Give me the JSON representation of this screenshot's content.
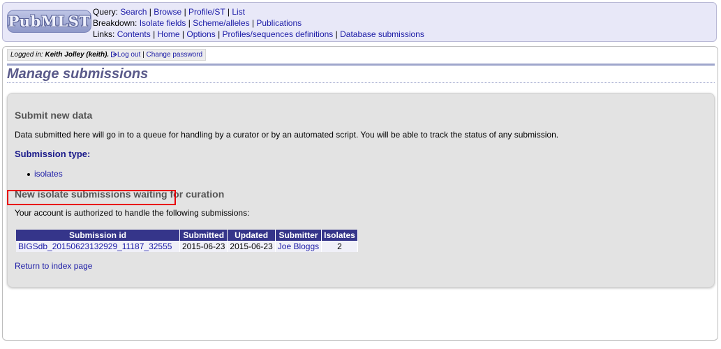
{
  "logo": {
    "text": "PubMLST"
  },
  "nav": {
    "query_label": "Query:",
    "query_links": [
      "Search",
      "Browse",
      "Profile/ST",
      "List"
    ],
    "breakdown_label": "Breakdown:",
    "breakdown_links": [
      "Isolate fields",
      "Scheme/alleles",
      "Publications"
    ],
    "links_label": "Links:",
    "links_links": [
      "Contents",
      "Home",
      "Options",
      "Profiles/sequences definitions",
      "Database submissions"
    ]
  },
  "login": {
    "prefix": "Logged in:",
    "user": "Keith Jolley (keith).",
    "logout": "Log out",
    "change_password": "Change password"
  },
  "page_title": "Manage submissions",
  "submit": {
    "heading": "Submit new data",
    "description": "Data submitted here will go in to a queue for handling by a curator or by an automated script. You will be able to track the status of any submission.",
    "type_heading": "Submission type:",
    "types": [
      "isolates"
    ]
  },
  "waiting": {
    "heading": "New isolate submissions waiting for curation",
    "description": "Your account is authorized to handle the following submissions:",
    "columns": [
      "Submission id",
      "Submitted",
      "Updated",
      "Submitter",
      "Isolates"
    ],
    "rows": [
      {
        "id": "BIGSdb_20150623132929_11187_32555",
        "submitted": "2015-06-23",
        "updated": "2015-06-23",
        "submitter": "Joe Bloggs",
        "isolates": "2"
      }
    ]
  },
  "return_link": "Return to index page",
  "colors": {
    "accent": "#35358a",
    "highlight": "#e8000b",
    "link": "#1a1aa6"
  }
}
